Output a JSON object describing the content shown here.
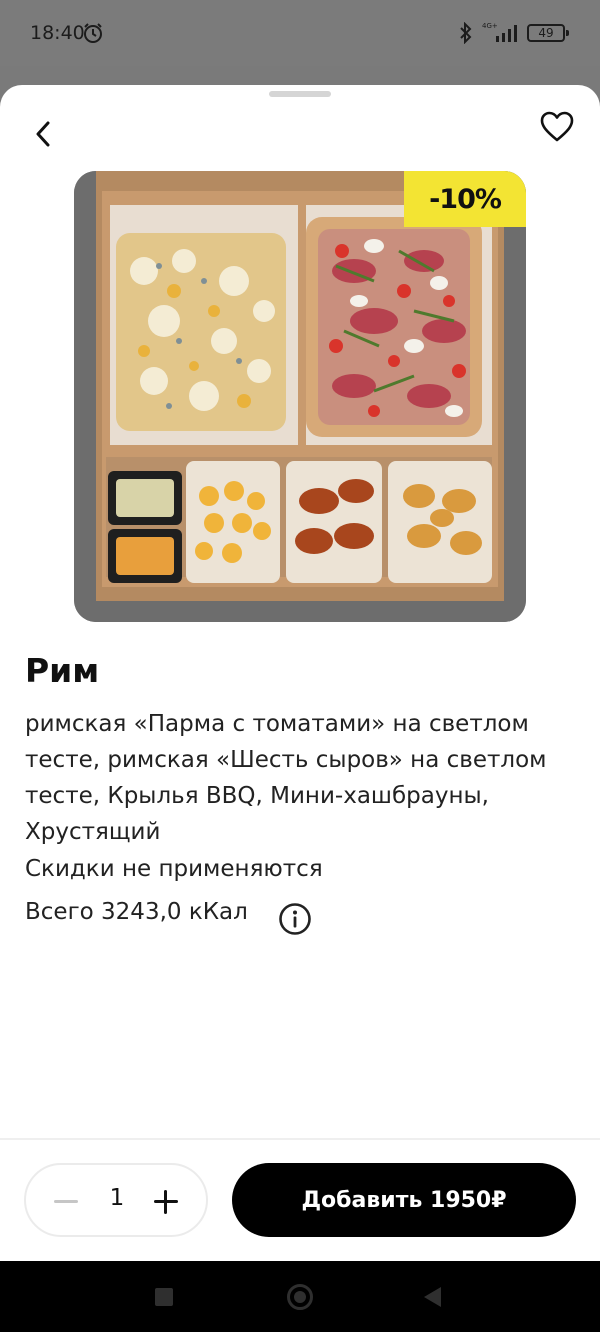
{
  "status_bar": {
    "time": "18:40",
    "network": "4G+",
    "battery": "49",
    "icons": [
      "alarm-icon",
      "bluetooth-icon",
      "signal-icon",
      "battery-icon"
    ]
  },
  "header": {
    "back_icon": "chevron-left-icon",
    "favorite_icon": "heart-outline-icon"
  },
  "product": {
    "image_description": "Combo box: two roman pizzas, mini hash browns, BBQ wings, crispy chicken, two sauces",
    "discount_badge": "-10%",
    "title": "Рим",
    "description": "римская «Парма с томатами» на светлом тесте, римская «Шесть сыров» на светлом тесте, Крылья BBQ, Мини-хашбрауны, Хрустящий",
    "note": "Скидки не применяются",
    "calories": "Всего 3243,0 кКал",
    "info_icon": "info-circle-icon"
  },
  "cart": {
    "quantity": "1",
    "minus_icon": "minus-icon",
    "plus_icon": "plus-icon",
    "add_button_label": "Добавить 1950₽"
  },
  "colors": {
    "accent_badge": "#f3e433",
    "primary_button": "#000000",
    "background": "#ffffff"
  }
}
